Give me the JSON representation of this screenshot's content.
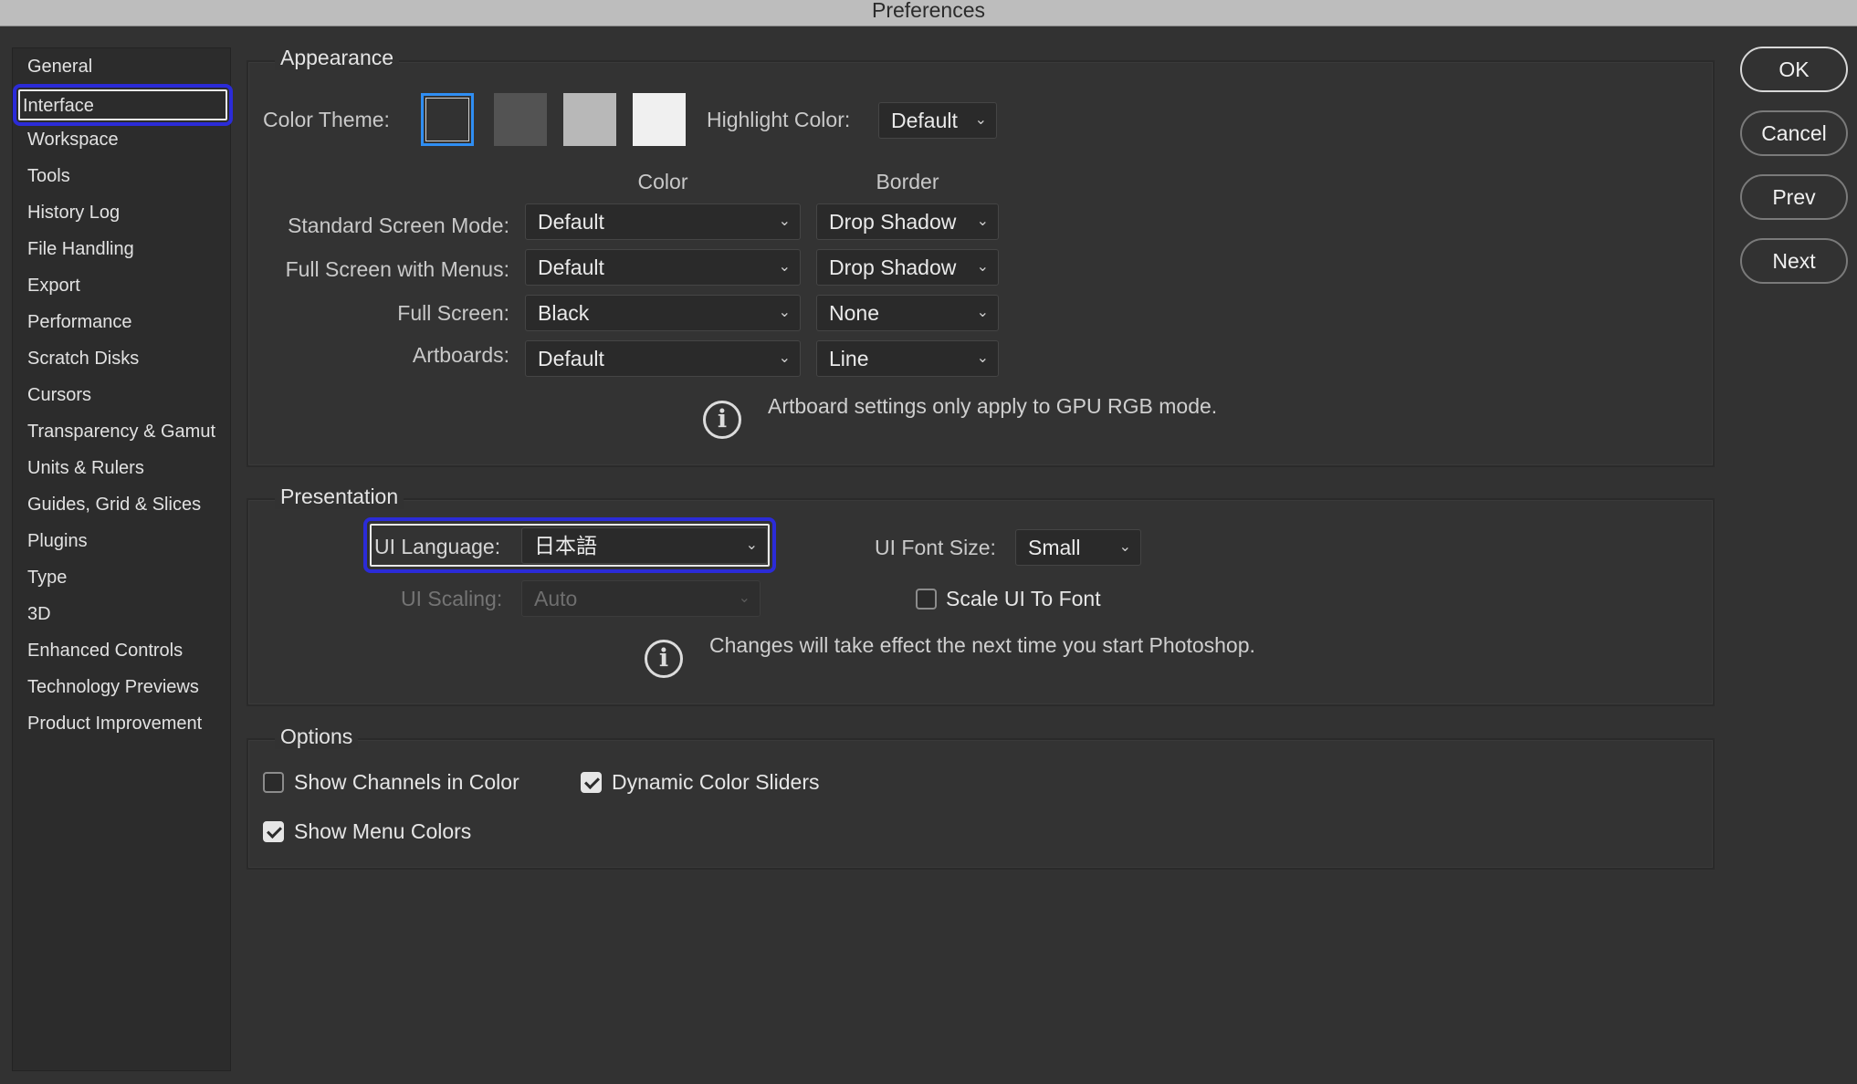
{
  "window": {
    "title": "Preferences"
  },
  "sidebar": {
    "items": [
      {
        "label": "General"
      },
      {
        "label": "Interface",
        "selected": true
      },
      {
        "label": "Workspace"
      },
      {
        "label": "Tools"
      },
      {
        "label": "History Log"
      },
      {
        "label": "File Handling"
      },
      {
        "label": "Export"
      },
      {
        "label": "Performance"
      },
      {
        "label": "Scratch Disks"
      },
      {
        "label": "Cursors"
      },
      {
        "label": "Transparency & Gamut"
      },
      {
        "label": "Units & Rulers"
      },
      {
        "label": "Guides, Grid & Slices"
      },
      {
        "label": "Plugins"
      },
      {
        "label": "Type"
      },
      {
        "label": "3D"
      },
      {
        "label": "Enhanced Controls"
      },
      {
        "label": "Technology Previews"
      },
      {
        "label": "Product Improvement"
      }
    ]
  },
  "appearance": {
    "title": "Appearance",
    "color_theme_label": "Color Theme:",
    "themes": [
      {
        "name": "darkest",
        "color": "#323232",
        "selected": true
      },
      {
        "name": "dark",
        "color": "#535353",
        "selected": false
      },
      {
        "name": "medium",
        "color": "#b8b8b8",
        "selected": false
      },
      {
        "name": "light",
        "color": "#f0f0f0",
        "selected": false
      }
    ],
    "highlight_label": "Highlight Color:",
    "highlight_value": "Default",
    "color_header": "Color",
    "border_header": "Border",
    "rows": [
      {
        "label": "Standard Screen Mode:",
        "color": "Default",
        "border": "Drop Shadow"
      },
      {
        "label": "Full Screen with Menus:",
        "color": "Default",
        "border": "Drop Shadow"
      },
      {
        "label": "Full Screen:",
        "color": "Black",
        "border": "None"
      },
      {
        "label": "Artboards:",
        "color": "Default",
        "border": "Line"
      }
    ],
    "note": "Artboard settings only apply to GPU RGB mode."
  },
  "presentation": {
    "title": "Presentation",
    "ui_language_label": "UI Language:",
    "ui_language_value": "日本語",
    "ui_font_size_label": "UI Font Size:",
    "ui_font_size_value": "Small",
    "ui_scaling_label": "UI Scaling:",
    "ui_scaling_value": "Auto",
    "scale_ui_to_font_label": "Scale UI To Font",
    "scale_ui_to_font_checked": false,
    "note": "Changes will take effect the next time you start Photoshop."
  },
  "options": {
    "title": "Options",
    "show_channels_label": "Show Channels in Color",
    "show_channels_checked": false,
    "dynamic_sliders_label": "Dynamic Color Sliders",
    "dynamic_sliders_checked": true,
    "show_menu_colors_label": "Show Menu Colors",
    "show_menu_colors_checked": true
  },
  "buttons": {
    "ok": "OK",
    "cancel": "Cancel",
    "prev": "Prev",
    "next": "Next"
  },
  "colors": {
    "accent_focus": "#2b2bd8",
    "theme_select": "#2f8ef3",
    "background": "#323232"
  }
}
